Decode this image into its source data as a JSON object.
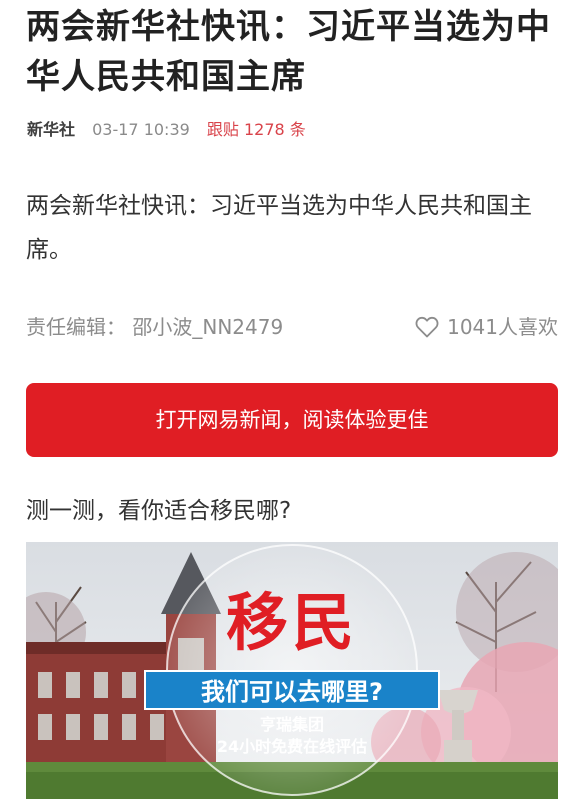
{
  "article": {
    "title": "两会新华社快讯：习近平当选为中华人民共和国主席",
    "source": "新华社",
    "time": "03-17 10:39",
    "comments": "跟贴 1278 条",
    "body": "两会新华社快讯：习近平当选为中华人民共和国主席。",
    "editor": "责任编辑：  邵小波_NN2479",
    "likes": "1041人喜欢"
  },
  "cta": {
    "label": "打开网易新闻，阅读体验更佳"
  },
  "promo": {
    "quiz": "测一测，看你适合移民哪?",
    "ad_title": "移民",
    "ad_banner": "我们可以去哪里?",
    "ad_company": "亨瑞集团",
    "ad_eval": "24小时免费在线评估"
  },
  "colors": {
    "accent": "#e01e24",
    "comment_red": "#d9434a",
    "banner_blue": "#1a83c9"
  },
  "icons": {
    "like": "heart-outline-icon"
  }
}
